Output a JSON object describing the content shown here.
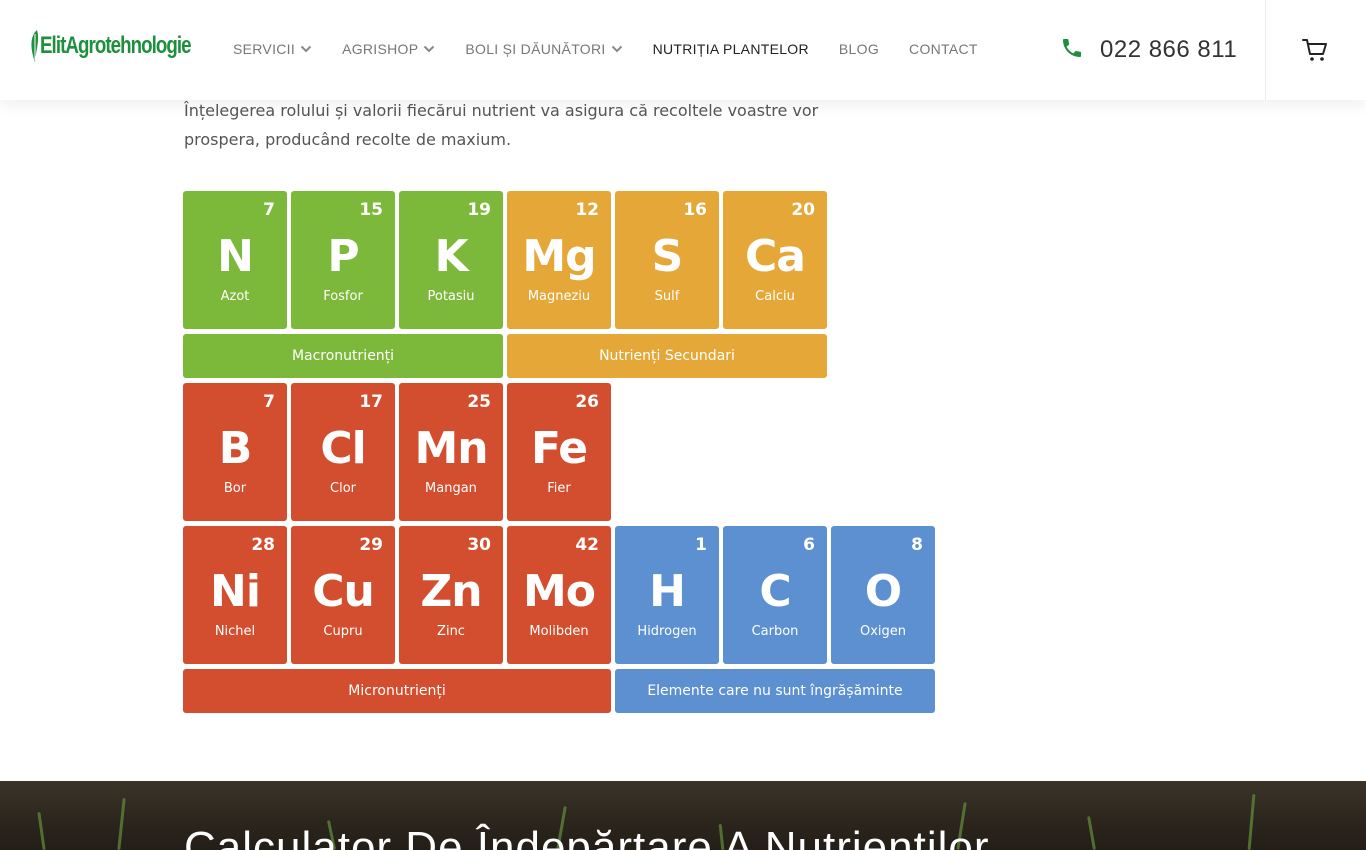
{
  "brand": {
    "logo_text_prefix": "Elit",
    "logo_text_main": "Agrotehnologie",
    "accent_color": "#1e8f3c"
  },
  "nav": {
    "items": [
      {
        "label": "SERVICII",
        "dropdown": true
      },
      {
        "label": "AGRISHOP",
        "dropdown": true
      },
      {
        "label": "BOLI ȘI DĂUNĂTORI",
        "dropdown": true
      },
      {
        "label": "NUTRIȚIA PLANTELOR",
        "dropdown": false,
        "active": true
      },
      {
        "label": "BLOG",
        "dropdown": false
      },
      {
        "label": "CONTACT",
        "dropdown": false
      }
    ]
  },
  "contact": {
    "phone_icon": "phone-icon",
    "phone": "022 866 811"
  },
  "cart": {
    "icon": "cart-icon"
  },
  "intro": "Înțelegerea rolului și valorii fiecărui nutrient va asigura că recoltele voastre vor prospera, producând recolte de maxium.",
  "colors": {
    "macro": "#7cb93b",
    "secondary": "#e5a838",
    "micro": "#d24e2f",
    "non_fertilizer": "#5c90d1"
  },
  "elements": [
    {
      "num": "7",
      "sym": "N",
      "name": "Azot",
      "group": "green"
    },
    {
      "num": "15",
      "sym": "P",
      "name": "Fosfor",
      "group": "green"
    },
    {
      "num": "19",
      "sym": "K",
      "name": "Potasiu",
      "group": "green"
    },
    {
      "num": "12",
      "sym": "Mg",
      "name": "Magneziu",
      "group": "orange"
    },
    {
      "num": "16",
      "sym": "S",
      "name": "Sulf",
      "group": "orange"
    },
    {
      "num": "20",
      "sym": "Ca",
      "name": "Calciu",
      "group": "orange"
    },
    {
      "num": "7",
      "sym": "B",
      "name": "Bor",
      "group": "red"
    },
    {
      "num": "17",
      "sym": "Cl",
      "name": "Clor",
      "group": "red"
    },
    {
      "num": "25",
      "sym": "Mn",
      "name": "Mangan",
      "group": "red"
    },
    {
      "num": "26",
      "sym": "Fe",
      "name": "Fier",
      "group": "red"
    },
    {
      "num": "28",
      "sym": "Ni",
      "name": "Nichel",
      "group": "red"
    },
    {
      "num": "29",
      "sym": "Cu",
      "name": "Cupru",
      "group": "red"
    },
    {
      "num": "30",
      "sym": "Zn",
      "name": "Zinc",
      "group": "red"
    },
    {
      "num": "42",
      "sym": "Mo",
      "name": "Molibden",
      "group": "red"
    },
    {
      "num": "1",
      "sym": "H",
      "name": "Hidrogen",
      "group": "blue"
    },
    {
      "num": "6",
      "sym": "C",
      "name": "Carbon",
      "group": "blue"
    },
    {
      "num": "8",
      "sym": "O",
      "name": "Oxigen",
      "group": "blue"
    }
  ],
  "bands": {
    "macro": "Macronutrienți",
    "secondary": "Nutrienți Secundari",
    "micro": "Micronutrienți",
    "non_fertilizer": "Elemente care nu sunt îngrășăminte"
  },
  "banner": {
    "title": "Calculator De Îndepărtare A Nutrienților"
  }
}
